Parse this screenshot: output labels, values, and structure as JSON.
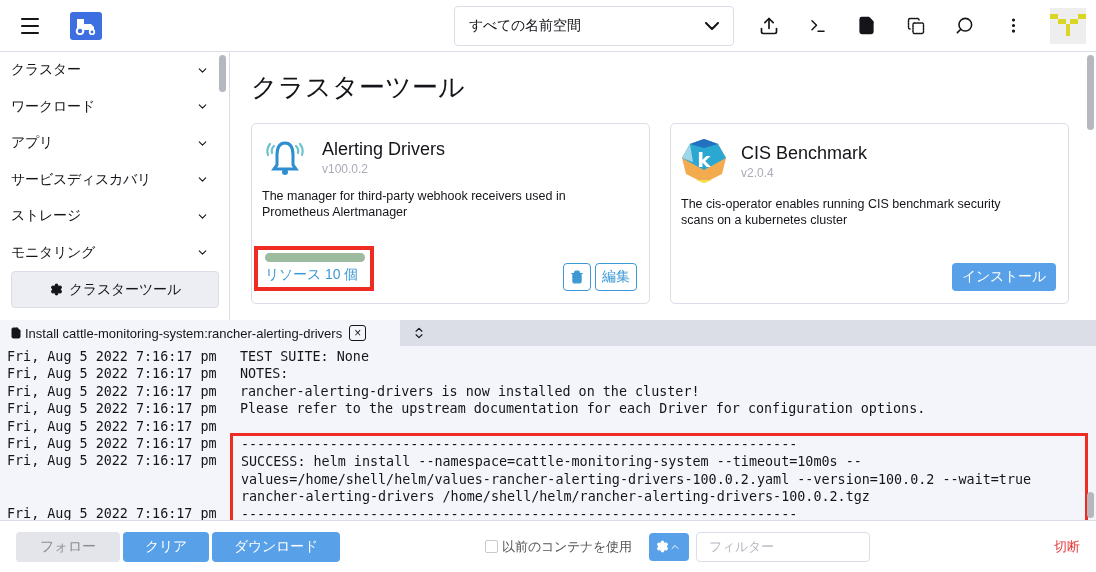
{
  "header": {
    "namespace_select": {
      "value": "すべての名前空間"
    }
  },
  "sidebar": {
    "items": [
      {
        "label": "クラスター",
        "expanded": false
      },
      {
        "label": "ワークロード",
        "expanded": false
      },
      {
        "label": "アプリ",
        "expanded": false
      },
      {
        "label": "サービスディスカバリ",
        "expanded": false
      },
      {
        "label": "ストレージ",
        "expanded": false
      },
      {
        "label": "モニタリング",
        "expanded": false
      }
    ],
    "active_link": {
      "label": "クラスターツール",
      "selected": true
    }
  },
  "main": {
    "title": "クラスターツール",
    "cards": [
      {
        "kind": "installed",
        "title": "Alerting Drivers",
        "version": "v100.0.2",
        "description": "The manager for third-party webhook receivers used in Prometheus Alertmanager",
        "resources": {
          "level": 1,
          "link": "リソース 10 個",
          "highlighted": true
        },
        "edit_button": "編集"
      },
      {
        "kind": "available",
        "logo_letter": "k",
        "title": "CIS Benchmark",
        "version": "v2.0.4",
        "description": "The cis-operator enables running CIS benchmark security scans on a kubernetes cluster",
        "install_button": "インストール"
      }
    ]
  },
  "log_panel": {
    "tab": {
      "title": "Install cattle-monitoring-system:rancher-alerting-drivers",
      "close": "×",
      "selected": true
    },
    "entries": [
      {
        "time": "Fri, Aug 5 2022 7:16:17 pm",
        "lines": [
          "TEST SUITE: None"
        ],
        "highlighted": false
      },
      {
        "time": "Fri, Aug 5 2022 7:16:17 pm",
        "lines": [
          "NOTES:"
        ],
        "highlighted": false
      },
      {
        "time": "Fri, Aug 5 2022 7:16:17 pm",
        "lines": [
          "rancher-alerting-drivers is now installed on the cluster!"
        ],
        "highlighted": false
      },
      {
        "time": "Fri, Aug 5 2022 7:16:17 pm",
        "lines": [
          "Please refer to the upstream documentation for each Driver for configuration options."
        ],
        "highlighted": false
      },
      {
        "time": "Fri, Aug 5 2022 7:16:17 pm",
        "highlighted": false
      },
      {
        "time": "Fri, Aug 5 2022 7:16:17 pm",
        "lines": [
          "---------------------------------------------------------------------"
        ],
        "highlighted": true
      },
      {
        "time": "Fri, Aug 5 2022 7:16:17 pm",
        "lines": [
          "SUCCESS: helm install --namespace=cattle-monitoring-system --timeout=10m0s --",
          "values=/home/shell/helm/values-rancher-alerting-drivers-100.0.2.yaml --version=100.0.2 --wait=true",
          "rancher-alerting-drivers /home/shell/helm/rancher-alerting-drivers-100.0.2.tgz"
        ],
        "highlighted": true
      },
      {
        "time": "Fri, Aug 5 2022 7:16:17 pm",
        "lines": [
          "---------------------------------------------------------------------"
        ],
        "highlighted": true
      }
    ],
    "footer": {
      "follow_button": {
        "label": "フォロー",
        "disabled": true
      },
      "clear_button": {
        "label": "クリア",
        "disabled": false
      },
      "download_button": {
        "label": "ダウンロード",
        "disabled": false
      },
      "previous_container": {
        "label": "以前のコンテナを使用",
        "checked": false
      },
      "filter": {
        "placeholder": "フィルター"
      },
      "disconnect": "切断"
    }
  }
}
